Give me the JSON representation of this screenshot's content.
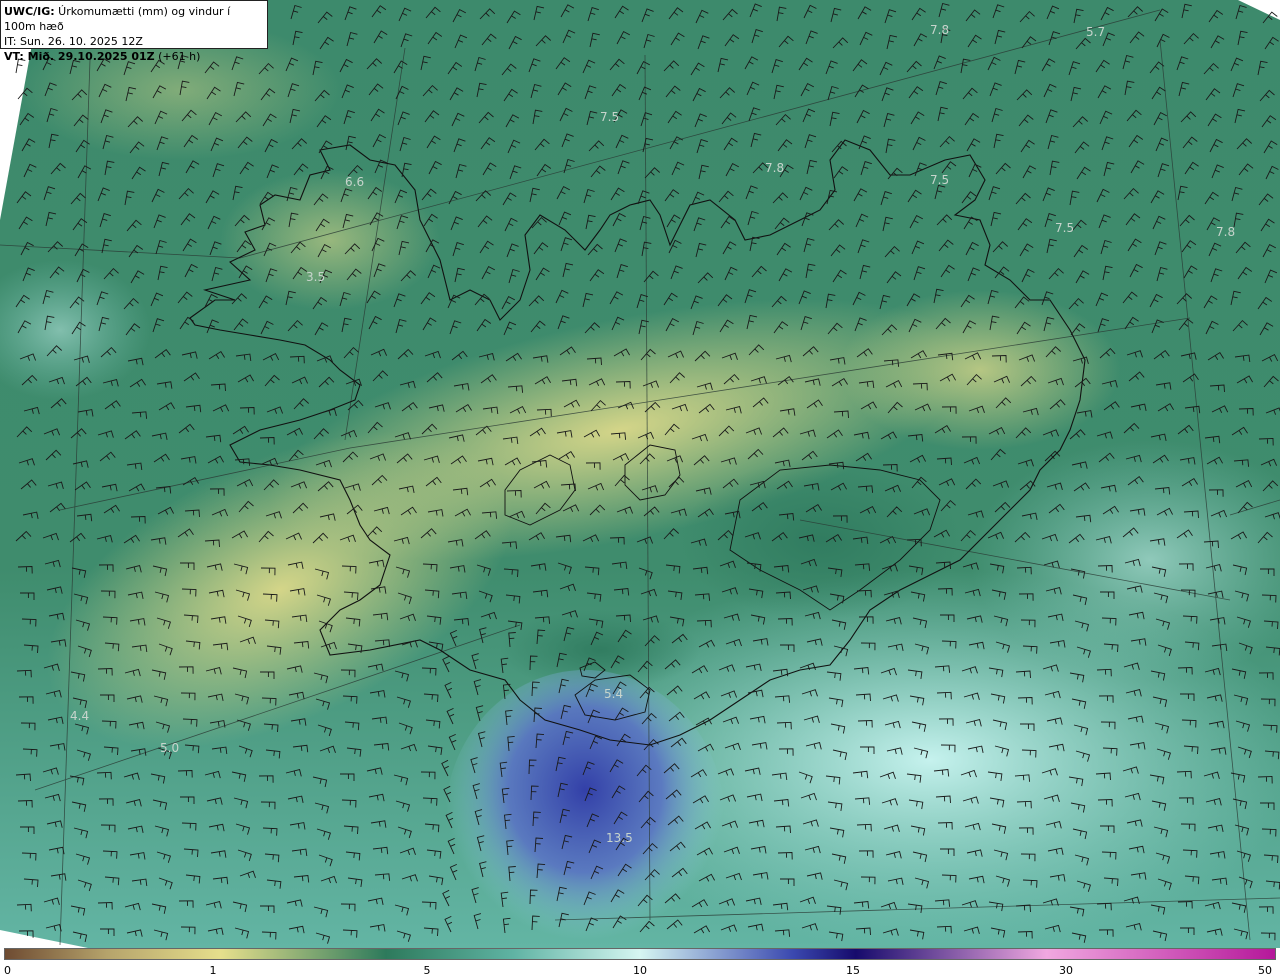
{
  "header": {
    "model": "UWC/IG:",
    "field": " Úrkomumætti (mm) og vindur í 100m hæð",
    "init_time": "IT: Sun. 26. 10. 2025 12Z",
    "valid_label": "VT: Mið. 29.10.2025 01Z",
    "lead": " (+61 h)"
  },
  "value_labels": [
    "7.8",
    "5.7",
    "7.5",
    "6.6",
    "7.8",
    "7.5",
    "7.5",
    "7.8",
    "3.5",
    "5.4",
    "4.4",
    "5.0",
    "13.5"
  ],
  "colorbar": {
    "ticks": [
      "0",
      "1",
      "5",
      "10",
      "15",
      "30",
      "50"
    ],
    "colors": [
      "#6e4b32",
      "#b5a36b",
      "#e6df8c",
      "#2d7a5c",
      "#5fb3a3",
      "#d6f6f2",
      "#3b49b0",
      "#160b6c",
      "#f0a8e0",
      "#b5179a"
    ]
  },
  "palette": {
    "land_low": "#3f8a6c",
    "land_yellow": "#d6d585",
    "sea_dark": "#2f7c62",
    "sea_light": "#9fe0d6",
    "heavy_blue": "#3e4fb4"
  }
}
